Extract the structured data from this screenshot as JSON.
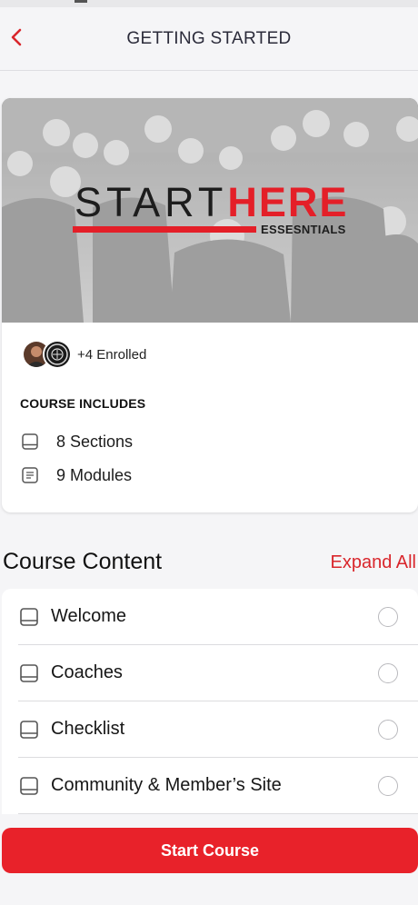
{
  "header": {
    "title": "GETTING STARTED",
    "back_icon": "chevron-left-icon",
    "accent": "#d9262c"
  },
  "course": {
    "hero": {
      "title_part1": "START",
      "title_part2": "HERE",
      "subtitle": "ESSESNTIALS",
      "brand_red": "#e41f28"
    },
    "enrolled_text": "+4 Enrolled",
    "includes_title": "COURSE INCLUDES",
    "includes": [
      {
        "icon": "book-icon",
        "label": "8 Sections"
      },
      {
        "icon": "document-icon",
        "label": "9 Modules"
      }
    ]
  },
  "content": {
    "heading": "Course Content",
    "expand_label": "Expand All",
    "lessons": [
      {
        "icon": "book-icon",
        "label": "Welcome",
        "completed": false
      },
      {
        "icon": "book-icon",
        "label": "Coaches",
        "completed": false
      },
      {
        "icon": "book-icon",
        "label": "Checklist",
        "completed": false
      },
      {
        "icon": "book-icon",
        "label": "Community & Member’s Site",
        "completed": false
      }
    ]
  },
  "footer": {
    "start_label": "Start Course",
    "button_color": "#e8222a"
  }
}
